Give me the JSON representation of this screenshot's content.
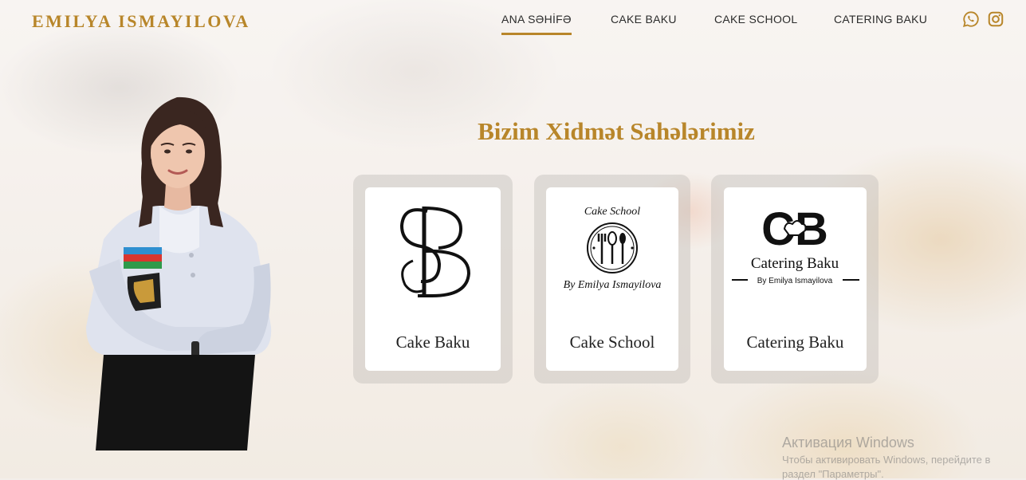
{
  "header": {
    "brand": "EMILYA ISMAYILOVA",
    "nav": [
      {
        "label": "ANA SƏHİFƏ",
        "active": true
      },
      {
        "label": "CAKE BAKU",
        "active": false
      },
      {
        "label": "CAKE SCHOOL",
        "active": false
      },
      {
        "label": "CATERING BAKU",
        "active": false
      }
    ],
    "social_icons": [
      "whatsapp-icon",
      "instagram-icon"
    ]
  },
  "services": {
    "title": "Bizim Xidmət Sahələrimiz",
    "cards": [
      {
        "label": "Cake Baku",
        "logo": "cb-monogram-logo"
      },
      {
        "label": "Cake School",
        "logo": "cake-school-logo",
        "logo_text_top": "Cake School",
        "logo_text_bottom": "By Emilya Ismayilova"
      },
      {
        "label": "Catering Baku",
        "logo": "catering-baku-logo",
        "logo_letters": "CB",
        "logo_name": "Catering Baku",
        "logo_byline": "By Emilya Ismayilova"
      }
    ]
  },
  "watermark": {
    "title": "Активация Windows",
    "line1": "Чтобы активировать Windows, перейдите в",
    "line2": "раздел \"Параметры\"."
  },
  "colors": {
    "accent": "#b8862a",
    "text": "#2b2b2b",
    "card_bg": "#ffffff"
  }
}
